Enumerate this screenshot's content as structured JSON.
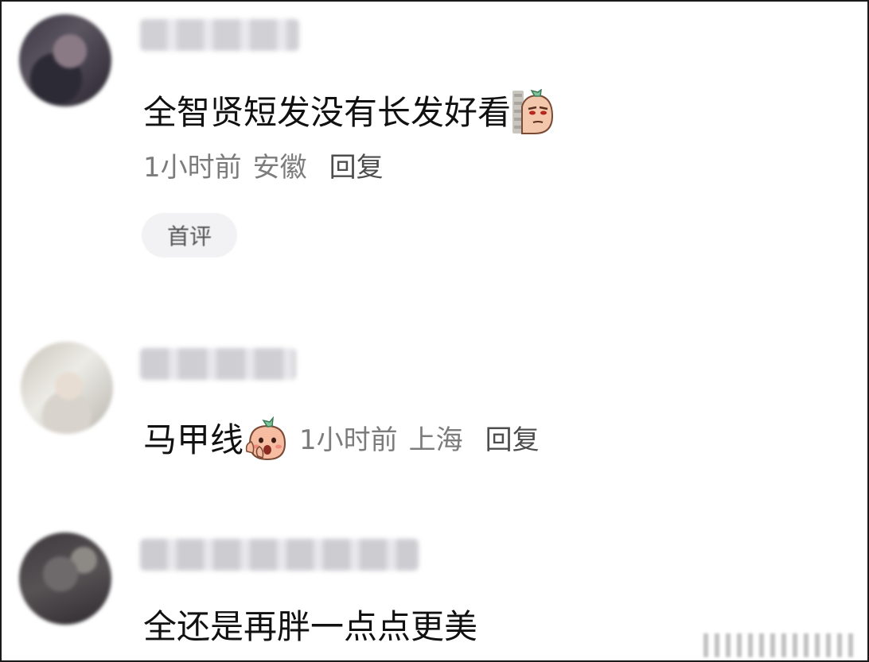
{
  "comments": [
    {
      "text": "全智贤短发没有长发好看",
      "emoji": "peeking-sweet-potato-emoji",
      "time": "1小时前",
      "location": "安徽",
      "reply_label": "回复",
      "badge": "首评"
    },
    {
      "text": "马甲线",
      "emoji": "shocked-sweet-potato-emoji",
      "time": "1小时前",
      "location": "上海",
      "reply_label": "回复"
    },
    {
      "text": "全还是再胖一点点更美"
    }
  ],
  "colors": {
    "text_primary": "#111111",
    "text_meta": "#7c7c7c",
    "badge_bg": "#f2f2f4",
    "border": "#1a1a1a"
  }
}
